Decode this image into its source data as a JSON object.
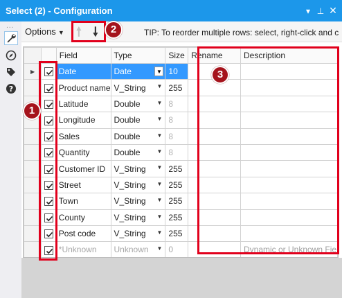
{
  "window": {
    "title": "Select (2) - Configuration",
    "controls": [
      "▾",
      "⊥",
      "✕"
    ]
  },
  "sidebar": {
    "icons": [
      {
        "name": "wrench-icon",
        "selected": true
      },
      {
        "name": "compass-icon",
        "selected": false
      },
      {
        "name": "tag-icon",
        "selected": false
      },
      {
        "name": "help-icon",
        "selected": false
      }
    ]
  },
  "toolbar": {
    "options_label": "Options",
    "tip_text": "TIP: To reorder multiple rows: select, right-click and c"
  },
  "grid": {
    "headers": {
      "field": "Field",
      "type": "Type",
      "size": "Size",
      "rename": "Rename",
      "description": "Description"
    },
    "rows": [
      {
        "checked": true,
        "field": "Date",
        "type": "Date",
        "size": "10",
        "selected": true,
        "rename": "",
        "description": ""
      },
      {
        "checked": true,
        "field": "Product name",
        "type": "V_String",
        "size": "255",
        "rename": "",
        "description": ""
      },
      {
        "checked": true,
        "field": "Latitude",
        "type": "Double",
        "size": "8",
        "rename": "",
        "description": ""
      },
      {
        "checked": true,
        "field": "Longitude",
        "type": "Double",
        "size": "8",
        "rename": "",
        "description": ""
      },
      {
        "checked": true,
        "field": "Sales",
        "type": "Double",
        "size": "8",
        "rename": "",
        "description": ""
      },
      {
        "checked": true,
        "field": "Quantity",
        "type": "Double",
        "size": "8",
        "rename": "",
        "description": ""
      },
      {
        "checked": true,
        "field": "Customer ID",
        "type": "V_String",
        "size": "255",
        "rename": "",
        "description": ""
      },
      {
        "checked": true,
        "field": "Street",
        "type": "V_String",
        "size": "255",
        "rename": "",
        "description": ""
      },
      {
        "checked": true,
        "field": "Town",
        "type": "V_String",
        "size": "255",
        "rename": "",
        "description": ""
      },
      {
        "checked": true,
        "field": "County",
        "type": "V_String",
        "size": "255",
        "rename": "",
        "description": ""
      },
      {
        "checked": true,
        "field": "Post code",
        "type": "V_String",
        "size": "255",
        "rename": "",
        "description": ""
      },
      {
        "checked": true,
        "field": "*Unknown",
        "type": "Unknown",
        "size": "0",
        "rename": "",
        "description": "Dynamic or Unknown Fie"
      }
    ]
  },
  "annotations": {
    "accent": "#e1001c",
    "badges": [
      "1",
      "2",
      "3"
    ]
  },
  "colors": {
    "titlebar": "#1c97ea",
    "selection": "#3399ff"
  }
}
